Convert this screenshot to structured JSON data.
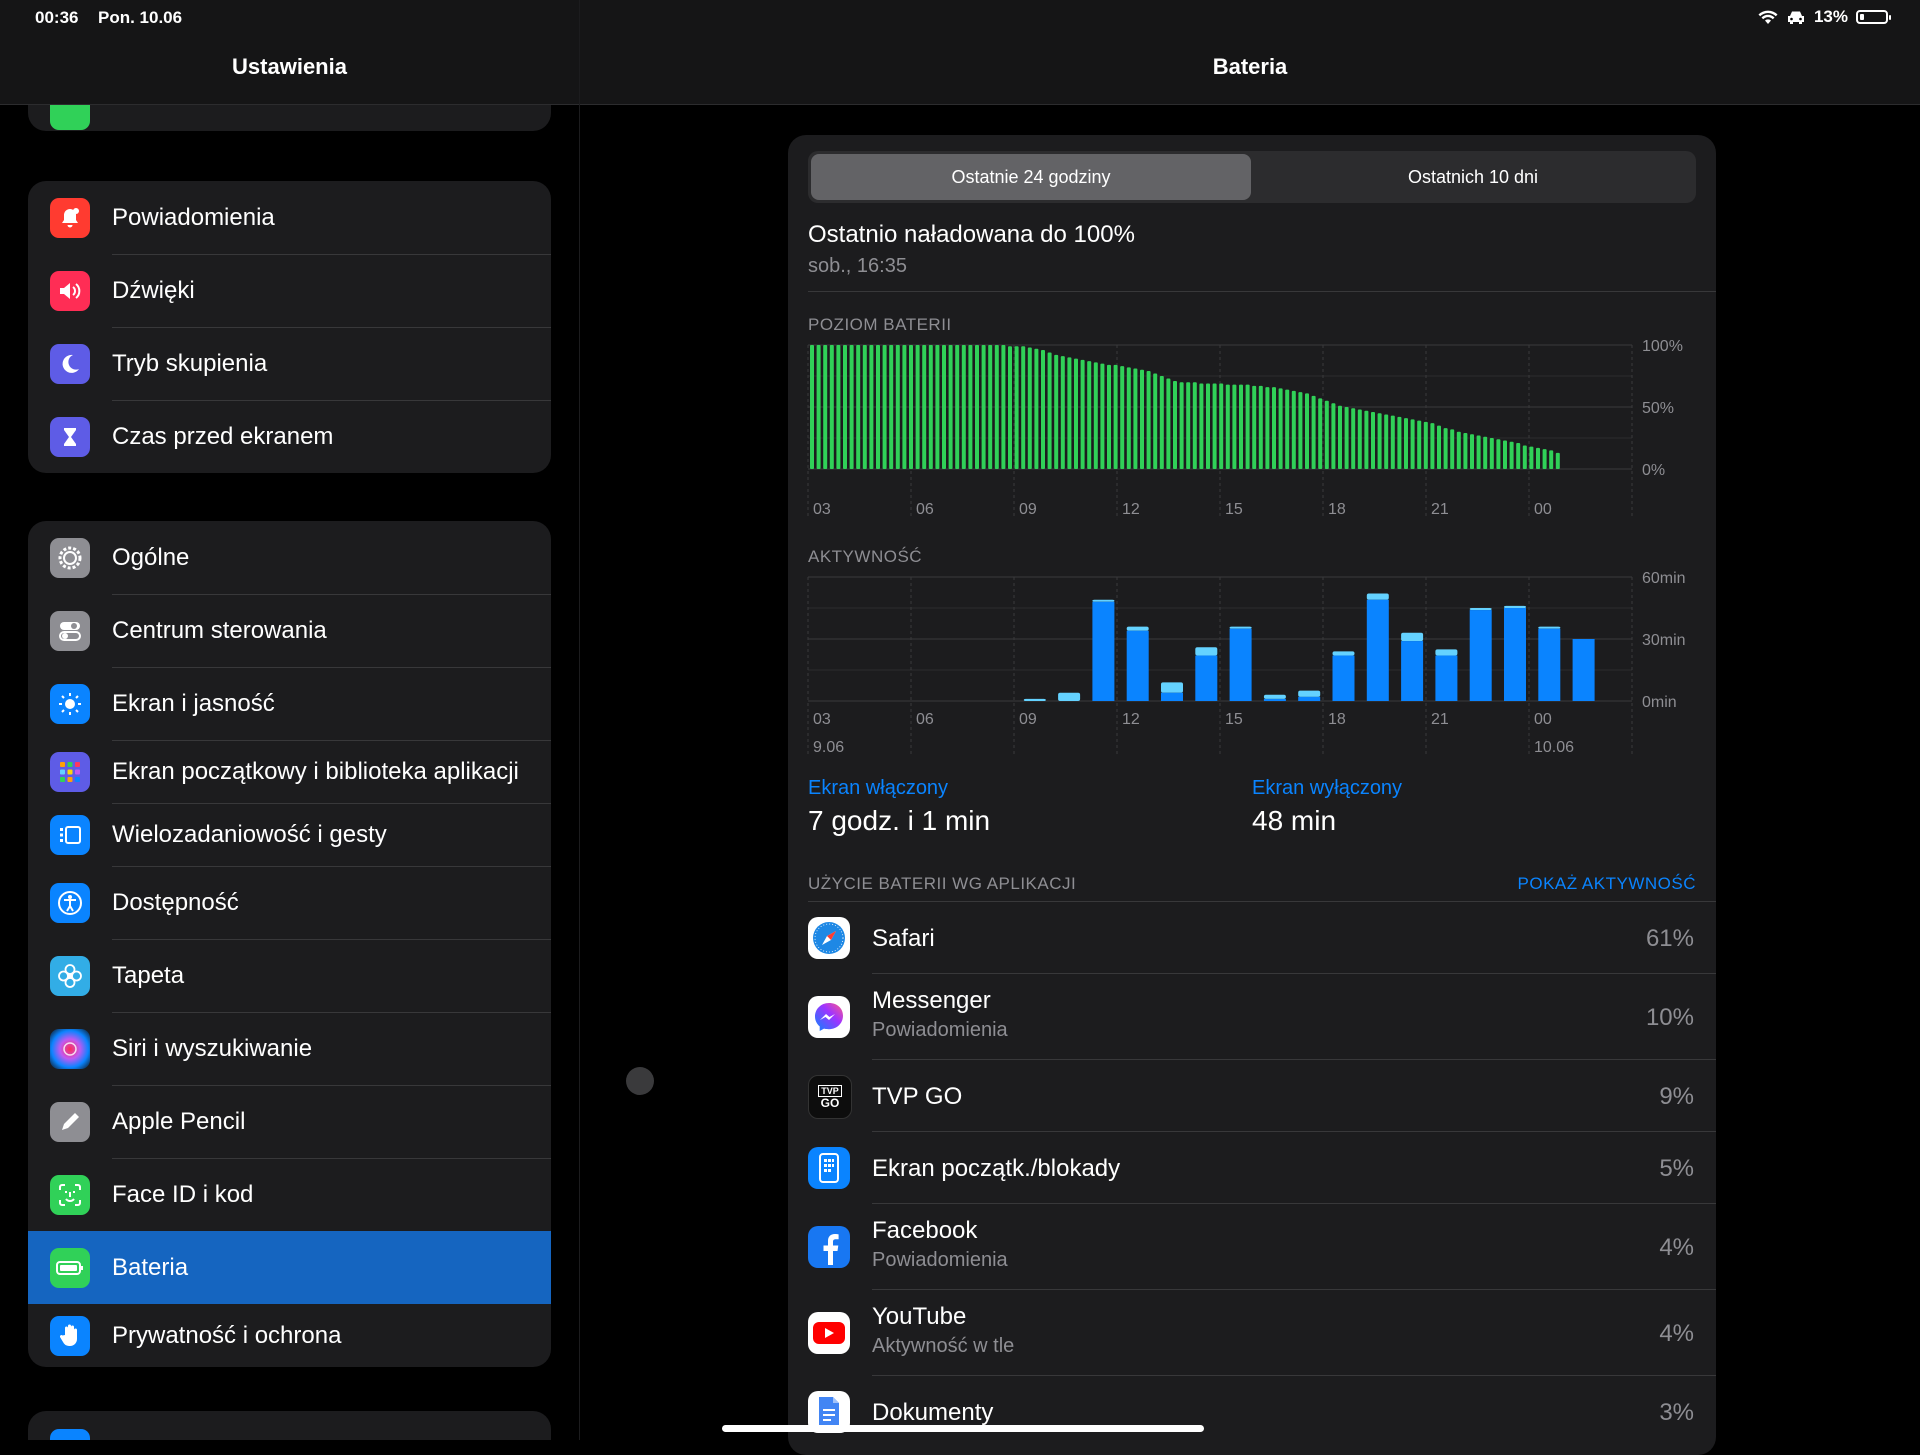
{
  "status_bar": {
    "time": "00:36",
    "date": "Pon. 10.06",
    "battery": "13%"
  },
  "sidebar": {
    "title": "Ustawienia",
    "groups": [
      {
        "items": [
          {
            "label": "Powiadomienia",
            "color": "#ff3b30",
            "icon": "bell-icon"
          },
          {
            "label": "Dźwięki",
            "color": "#ff2d55",
            "icon": "speaker-icon"
          },
          {
            "label": "Tryb skupienia",
            "color": "#5e5ce6",
            "icon": "moon-icon"
          },
          {
            "label": "Czas przed ekranem",
            "color": "#5e5ce6",
            "icon": "hourglass-icon"
          }
        ]
      },
      {
        "items": [
          {
            "label": "Ogólne",
            "color": "#8e8e93",
            "icon": "gear-icon"
          },
          {
            "label": "Centrum sterowania",
            "color": "#8e8e93",
            "icon": "toggles-icon"
          },
          {
            "label": "Ekran i jasność",
            "color": "#0a84ff",
            "icon": "sun-icon"
          },
          {
            "label": "Ekran początkowy i biblioteka aplikacji",
            "color": "#5e5ce6",
            "icon": "app-grid-icon"
          },
          {
            "label": "Wielozadaniowość i gesty",
            "color": "#0a84ff",
            "icon": "multitasking-icon"
          },
          {
            "label": "Dostępność",
            "color": "#0a84ff",
            "icon": "accessibility-icon"
          },
          {
            "label": "Tapeta",
            "color": "#32ade6",
            "icon": "flower-icon"
          },
          {
            "label": "Siri i wyszukiwanie",
            "color": "#1c1c1e",
            "icon": "siri-icon"
          },
          {
            "label": "Apple Pencil",
            "color": "#8e8e93",
            "icon": "pencil-icon"
          },
          {
            "label": "Face ID i kod",
            "color": "#30d158",
            "icon": "faceid-icon"
          },
          {
            "label": "Bateria",
            "color": "#30d158",
            "icon": "battery-icon",
            "selected": true
          },
          {
            "label": "Prywatność i ochrona",
            "color": "#0a84ff",
            "icon": "hand-icon"
          }
        ]
      }
    ]
  },
  "main": {
    "title": "Bateria",
    "segments": [
      "Ostatnie 24 godziny",
      "Ostatnich 10 dni"
    ],
    "last_charged": "Ostatnio naładowana do 100%",
    "last_charged_time": "sob., 16:35",
    "battery_chart_label": "POZIOM BATERII",
    "activity_chart_label": "AKTYWNOŚĆ",
    "stats": {
      "screen_on_label": "Ekran włączony",
      "screen_on_value": "7 godz. i 1 min",
      "screen_off_label": "Ekran wyłączony",
      "screen_off_value": "48 min"
    },
    "usage_title": "UŻYCIE BATERII WG APLIKACJI",
    "usage_link": "POKAŻ AKTYWNOŚĆ",
    "apps": [
      {
        "name": "Safari",
        "sub": "",
        "pct": "61%",
        "icon": "safari-icon"
      },
      {
        "name": "Messenger",
        "sub": "Powiadomienia",
        "pct": "10%",
        "icon": "messenger-icon"
      },
      {
        "name": "TVP GO",
        "sub": "",
        "pct": "9%",
        "icon": "tvp-go-icon"
      },
      {
        "name": "Ekran początk./blokady",
        "sub": "",
        "pct": "5%",
        "icon": "home-lock-screen-icon"
      },
      {
        "name": "Facebook",
        "sub": "Powiadomienia",
        "pct": "4%",
        "icon": "facebook-icon"
      },
      {
        "name": "YouTube",
        "sub": "Aktywność w tle",
        "pct": "4%",
        "icon": "youtube-icon"
      },
      {
        "name": "Dokumenty",
        "sub": "",
        "pct": "3%",
        "icon": "docs-icon"
      }
    ],
    "tvp_logo_text": {
      "top": "TVP",
      "bottom": "GO"
    }
  },
  "chart_data": [
    {
      "type": "bar",
      "title": "POZIOM BATERII",
      "x_tick_labels": [
        "03",
        "06",
        "09",
        "12",
        "15",
        "18",
        "21",
        "00"
      ],
      "y_tick_labels": [
        "100%",
        "50%",
        "0%"
      ],
      "ylim": [
        0,
        100
      ],
      "values": [
        100,
        100,
        100,
        100,
        100,
        100,
        100,
        100,
        100,
        100,
        100,
        100,
        100,
        100,
        100,
        100,
        100,
        100,
        100,
        100,
        100,
        100,
        100,
        100,
        100,
        100,
        100,
        100,
        100,
        100,
        99,
        99,
        99,
        98,
        97,
        96,
        94,
        92,
        91,
        90,
        89,
        88,
        87,
        86,
        85,
        84,
        84,
        83,
        82,
        81,
        80,
        79,
        77,
        75,
        73,
        71,
        70,
        70,
        70,
        69,
        69,
        69,
        69,
        68,
        68,
        68,
        68,
        67,
        67,
        66,
        66,
        65,
        64,
        63,
        62,
        61,
        59,
        57,
        55,
        53,
        51,
        50,
        49,
        48,
        47,
        46,
        45,
        44,
        43,
        42,
        41,
        40,
        39,
        38,
        37,
        35,
        33,
        32,
        30,
        29,
        28,
        27,
        26,
        25,
        24,
        23,
        22,
        21,
        19,
        18,
        17,
        16,
        15,
        13
      ],
      "color": "#30d158"
    },
    {
      "type": "bar",
      "title": "AKTYWNOŚĆ",
      "x_tick_labels": [
        "03",
        "06",
        "09",
        "12",
        "15",
        "18",
        "21",
        "00"
      ],
      "x_date_labels": [
        "9.06",
        "10.06"
      ],
      "y_tick_labels": [
        "60min",
        "30min",
        "0min"
      ],
      "ylim": [
        0,
        60
      ],
      "categories": [
        "03",
        "04",
        "05",
        "06",
        "07",
        "08",
        "09",
        "10",
        "11",
        "12",
        "13",
        "14",
        "15",
        "16",
        "17",
        "18",
        "19",
        "20",
        "21",
        "22",
        "23",
        "00"
      ],
      "series": [
        {
          "name": "Ekran włączony",
          "color": "#0a84ff",
          "values": [
            0,
            0,
            0,
            0,
            0,
            0,
            0,
            0,
            48,
            34,
            4,
            22,
            35,
            1,
            2,
            22,
            49,
            29,
            22,
            44,
            45,
            35,
            30
          ]
        },
        {
          "name": "Ekran wyłączony",
          "color": "#64d2ff",
          "values": [
            0,
            0,
            0,
            0,
            0,
            0,
            1,
            4,
            1,
            2,
            5,
            4,
            1,
            2,
            3,
            2,
            3,
            4,
            3,
            1,
            1,
            1,
            0
          ]
        }
      ]
    }
  ]
}
